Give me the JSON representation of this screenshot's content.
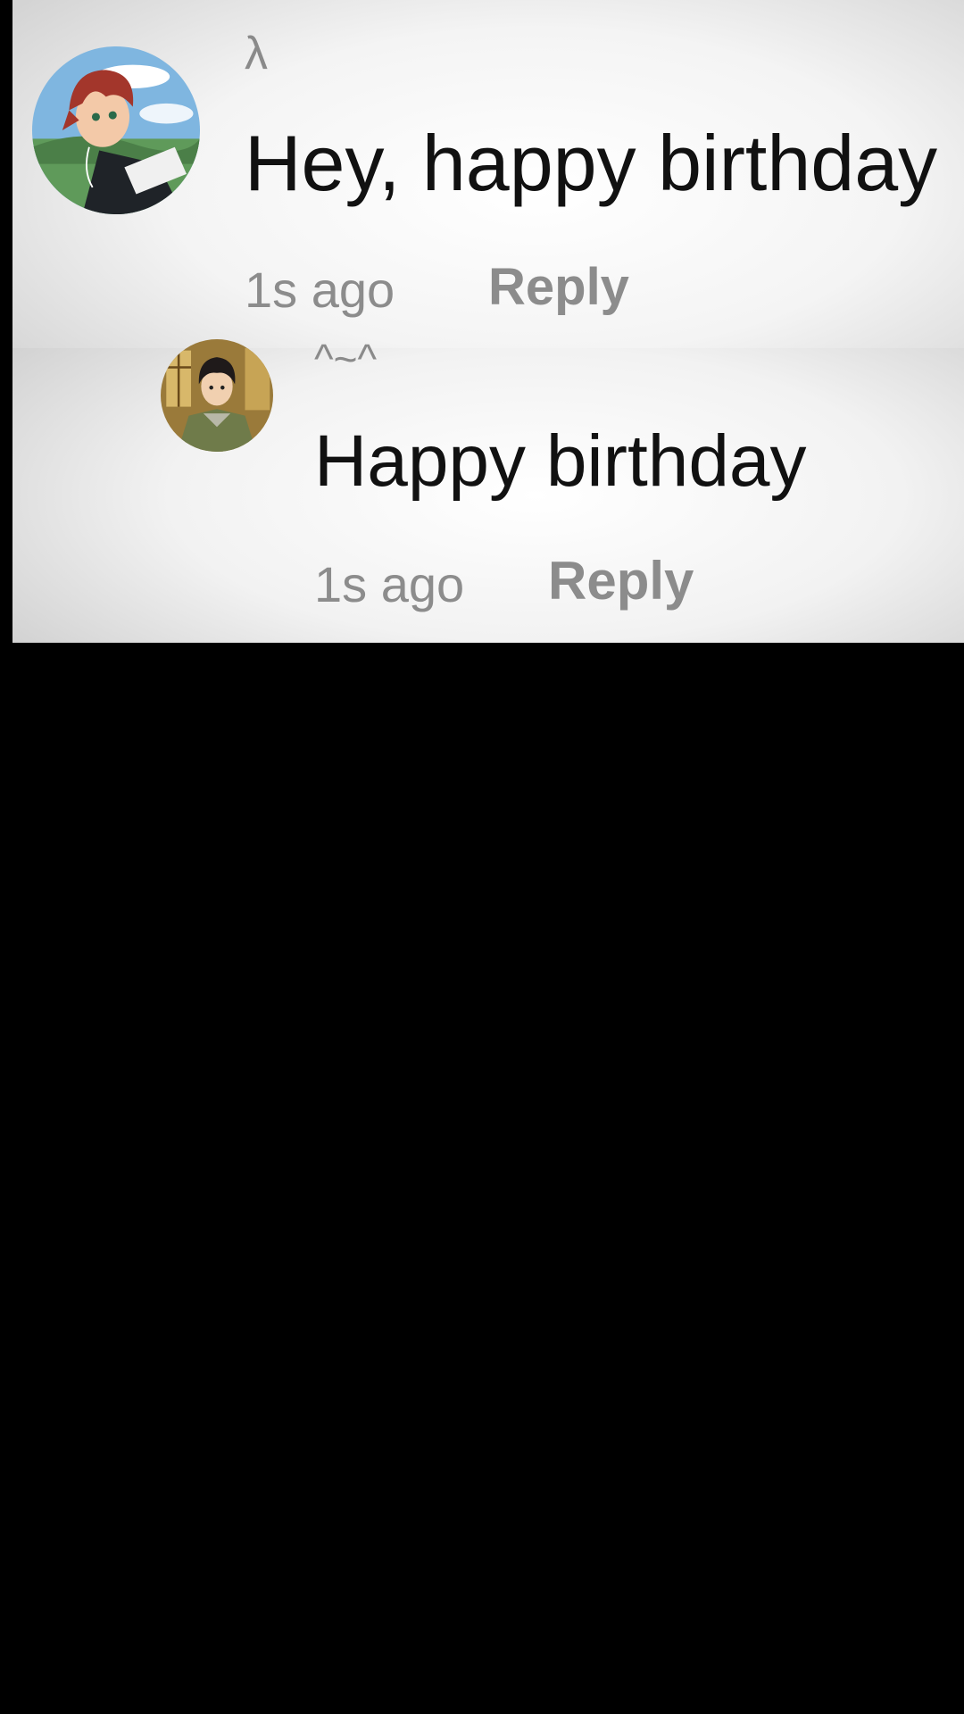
{
  "comments": [
    {
      "username": "λ",
      "text": "Hey, happy birthday",
      "timestamp": "1s ago",
      "reply_label": "Reply",
      "avatar_icon": "anime-boy-red-hair-avatar"
    },
    {
      "username": "^~^",
      "text": "Happy birthday",
      "timestamp": "1s ago",
      "reply_label": "Reply",
      "avatar_icon": "anime-boy-dark-hair-avatar"
    }
  ],
  "colors": {
    "background": "#000000",
    "panel": "#f4f4f4",
    "text": "#111111",
    "muted": "#8c8c8c"
  }
}
